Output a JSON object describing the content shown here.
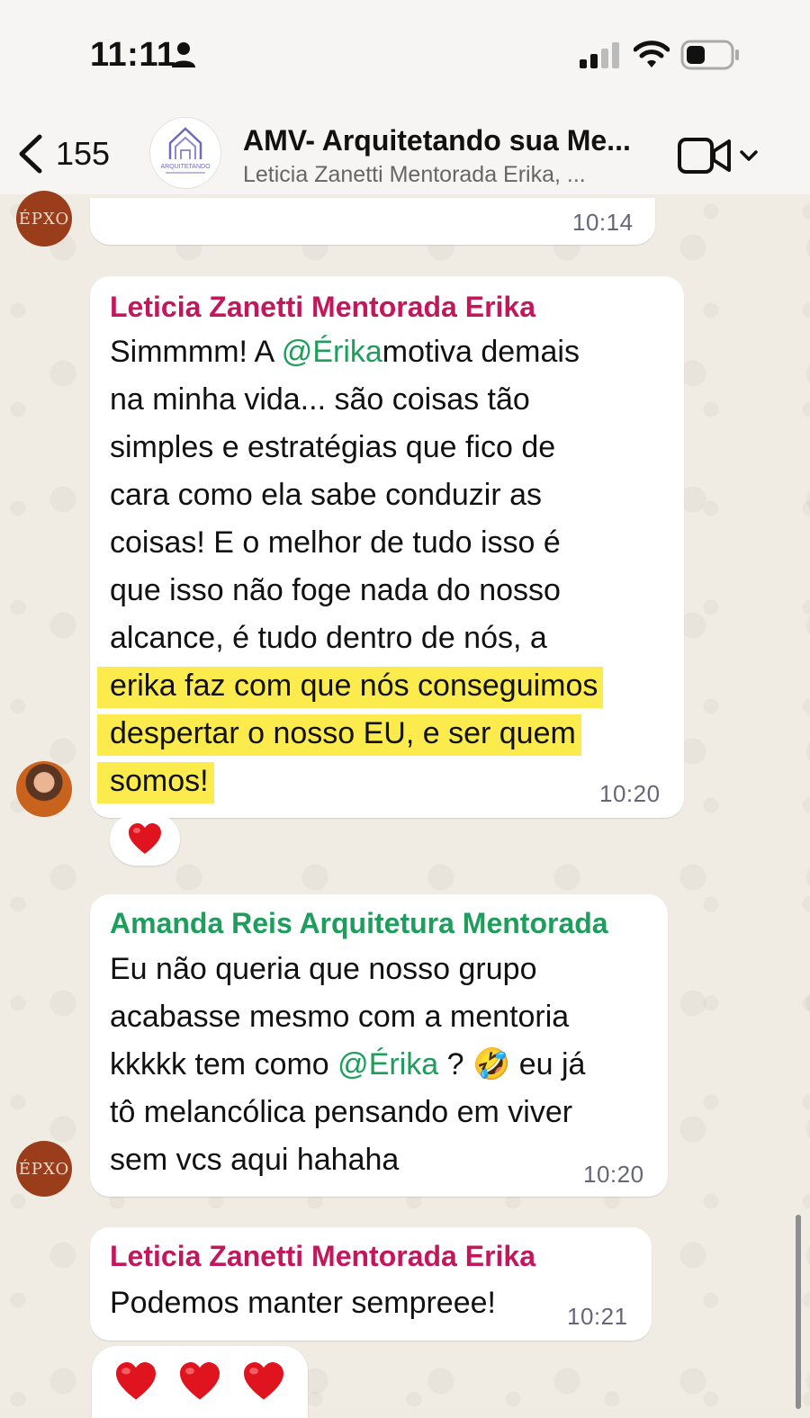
{
  "status_bar": {
    "time": "11:11"
  },
  "header": {
    "back_count": "155",
    "group_title": "AMV- Arquitetando sua Me...",
    "group_subtitle": "Leticia Zanetti Mentorada Erika, ...",
    "avatar_text": "ARQUITETANDO"
  },
  "messages": [
    {
      "time": "10:14",
      "avatar_text": "ÉPXO"
    },
    {
      "sender": "Leticia Zanetti Mentorada Erika",
      "sender_color": "#c2185b",
      "line1_pre": "Simmmm! A ",
      "mention": "@",
      "mention_name": "Érika",
      "line1_post": "motiva demais",
      "line2": "na minha vida... são coisas tão",
      "line3": "simples e estratégias que fico de",
      "line4": "cara como ela sabe conduzir as",
      "line5": "coisas! E o melhor de tudo isso é",
      "line6": "que isso não foge nada do nosso",
      "line7": "alcance, é tudo dentro de nós, a",
      "line8": "erika faz com que nós conseguimos",
      "line9": "despertar o nosso EU, e ser quem",
      "line10": "somos!",
      "time": "10:20"
    },
    {
      "sender": "Amanda Reis Arquitetura Mentorada",
      "sender_color": "#1f9d5c",
      "line1": "Eu não queria que nosso grupo",
      "line2": "acabasse mesmo com a mentoria",
      "line3_pre": "kkkkk tem como ",
      "mention": "@",
      "mention_name": "Érika",
      "line3_post": " ? 🤣 eu já",
      "line4": "tô melancólica pensando em viver",
      "line5": "sem vcs aqui hahaha",
      "time": "10:20",
      "avatar_text": "ÉPXO"
    },
    {
      "sender": "Leticia Zanetti Mentorada Erika",
      "line1": "Podemos manter sempreee!",
      "time": "10:21"
    }
  ],
  "reactions": {
    "single": "❤️",
    "triple": [
      "❤️",
      "❤️",
      "❤️"
    ]
  },
  "colors": {
    "highlight": "#fbeb4d",
    "mention": "#1f9d5c",
    "leticia": "#c2185b",
    "amanda": "#1f9d5c"
  },
  "icons": [
    "person-icon",
    "signal-icon",
    "wifi-icon",
    "battery-icon",
    "back-chevron-icon",
    "video-call-icon",
    "chevron-down-icon"
  ]
}
